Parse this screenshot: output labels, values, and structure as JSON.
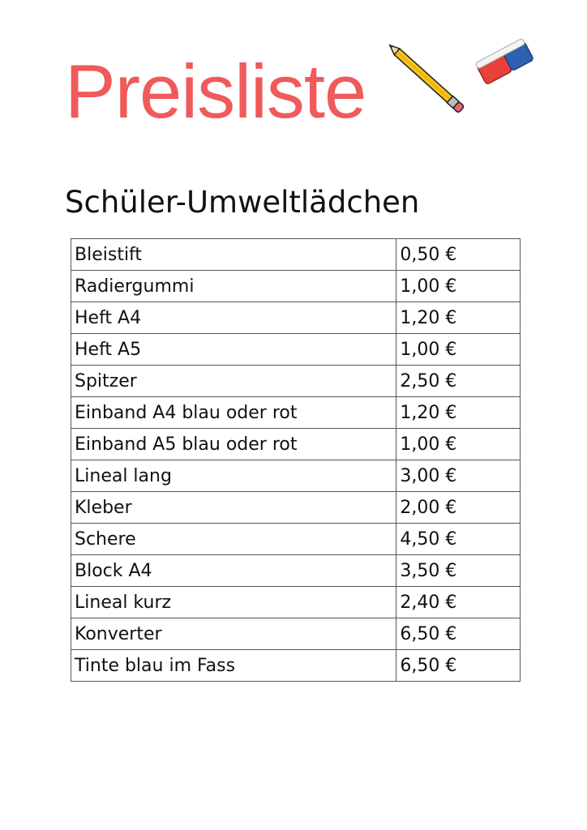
{
  "header": {
    "title": "Preisliste",
    "illustration": [
      "pencil-icon",
      "eraser-icon"
    ],
    "title_color": "#f05a5a"
  },
  "shop_name": "Schüler-Umweltlädchen",
  "price_list": [
    {
      "item": "Bleistift",
      "price": "0,50 €"
    },
    {
      "item": "Radiergummi",
      "price": "1,00 €"
    },
    {
      "item": "Heft A4",
      "price": "1,20 €"
    },
    {
      "item": "Heft A5",
      "price": "1,00 €"
    },
    {
      "item": "Spitzer",
      "price": "2,50 €"
    },
    {
      "item": "Einband A4 blau oder rot",
      "price": "1,20 €"
    },
    {
      "item": "Einband A5 blau oder rot",
      "price": "1,00 €"
    },
    {
      "item": "Lineal lang",
      "price": "3,00 €"
    },
    {
      "item": "Kleber",
      "price": "2,00 €"
    },
    {
      "item": "Schere",
      "price": "4,50 €"
    },
    {
      "item": "Block A4",
      "price": "3,50 €"
    },
    {
      "item": "Lineal kurz",
      "price": "2,40 €"
    },
    {
      "item": "Konverter",
      "price": "6,50 €"
    },
    {
      "item": "Tinte blau im Fass",
      "price": "6,50 €"
    }
  ]
}
